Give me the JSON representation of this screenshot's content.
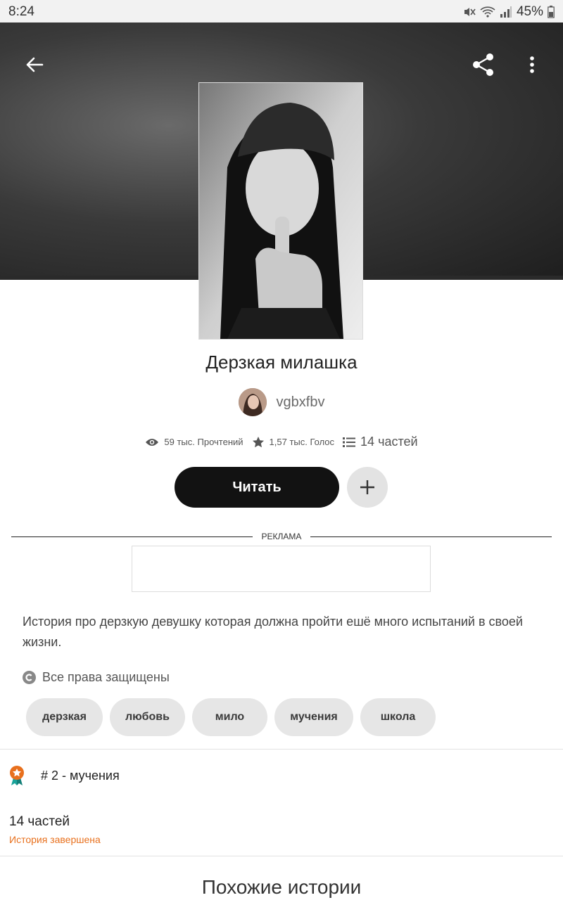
{
  "status_bar": {
    "time": "8:24",
    "battery": "45%"
  },
  "story": {
    "title": "Дерзкая милашка",
    "author": "vgbxfbv",
    "reads": "59 тыс. Прочтений",
    "votes": "1,57 тыс. Голос",
    "parts": "14 частей",
    "description": "История про дерзкую девушку которая должна пройти ешё много испытаний в своей жизни.",
    "rights": "Все права защищены",
    "tags": [
      "дерзкая",
      "любовь",
      "мило",
      "мучения",
      "школа"
    ],
    "rank": "# 2 - мучения",
    "parts_count": "14 частей",
    "completion": "История завершена"
  },
  "actions": {
    "read_label": "Читать"
  },
  "ad": {
    "label": "РЕКЛАМА"
  },
  "sections": {
    "similar_title": "Похожие истории"
  },
  "icons": {
    "back": "arrow-left-icon",
    "share": "share-icon",
    "more": "more-vertical-icon",
    "reads": "eye-icon",
    "votes": "star-icon",
    "parts": "list-icon",
    "add": "plus-icon",
    "rights": "copyright-icon",
    "rank": "rank-badge-icon"
  },
  "colors": {
    "accent": "#e8701d",
    "read_button": "#121212",
    "tag_bg": "#e6e6e6"
  }
}
